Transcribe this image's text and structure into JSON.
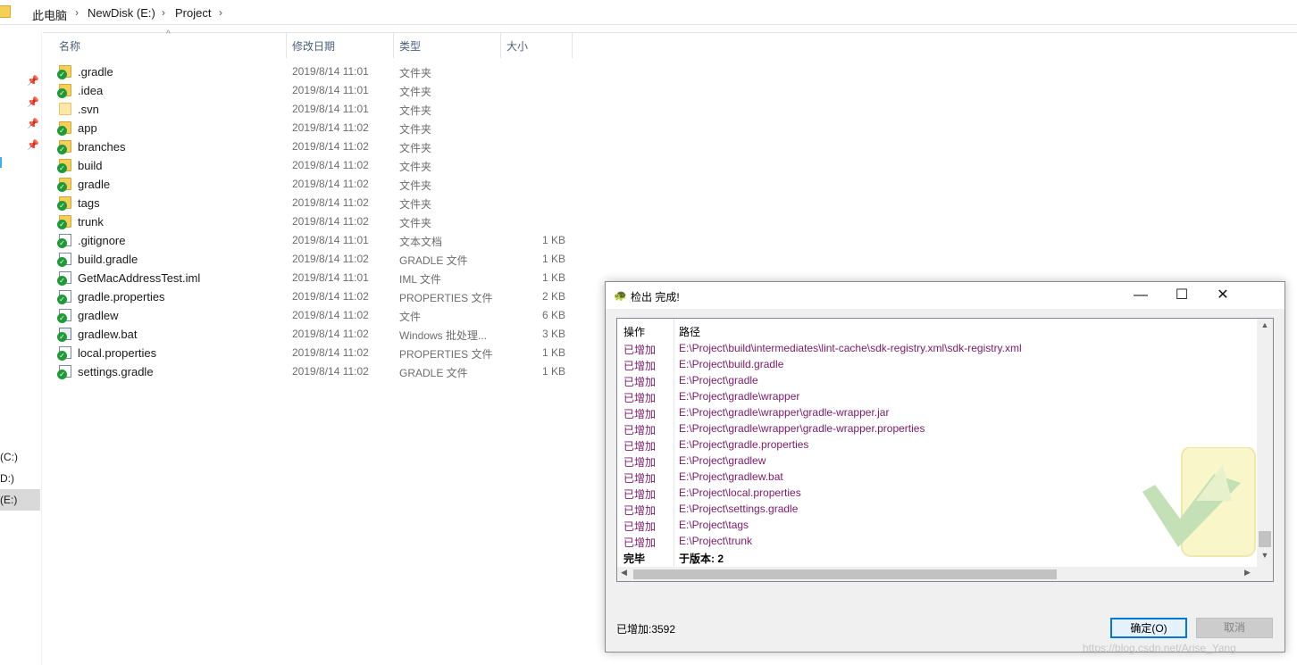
{
  "address_bar": {
    "crumbs": [
      "此电脑",
      "NewDisk (E:)",
      "Project"
    ],
    "separator": "›"
  },
  "columns": {
    "name": "名称",
    "date": "修改日期",
    "type": "类型",
    "size": "大小"
  },
  "nav": {
    "drives": [
      "(C:)",
      "D:)",
      "(E:)"
    ],
    "selected_drive": "(E:)"
  },
  "files": [
    {
      "name": ".gradle",
      "date": "2019/8/14 11:01",
      "type": "文件夹",
      "size": "",
      "icon": "folder-svn-ok-icon"
    },
    {
      "name": ".idea",
      "date": "2019/8/14 11:01",
      "type": "文件夹",
      "size": "",
      "icon": "folder-svn-ok-icon"
    },
    {
      "name": ".svn",
      "date": "2019/8/14 11:01",
      "type": "文件夹",
      "size": "",
      "icon": "folder-icon"
    },
    {
      "name": "app",
      "date": "2019/8/14 11:02",
      "type": "文件夹",
      "size": "",
      "icon": "folder-svn-ok-icon"
    },
    {
      "name": "branches",
      "date": "2019/8/14 11:02",
      "type": "文件夹",
      "size": "",
      "icon": "folder-svn-ok-icon"
    },
    {
      "name": "build",
      "date": "2019/8/14 11:02",
      "type": "文件夹",
      "size": "",
      "icon": "folder-svn-ok-icon"
    },
    {
      "name": "gradle",
      "date": "2019/8/14 11:02",
      "type": "文件夹",
      "size": "",
      "icon": "folder-svn-ok-icon"
    },
    {
      "name": "tags",
      "date": "2019/8/14 11:02",
      "type": "文件夹",
      "size": "",
      "icon": "folder-svn-ok-icon"
    },
    {
      "name": "trunk",
      "date": "2019/8/14 11:02",
      "type": "文件夹",
      "size": "",
      "icon": "folder-svn-ok-icon"
    },
    {
      "name": ".gitignore",
      "date": "2019/8/14 11:01",
      "type": "文本文档",
      "size": "1 KB",
      "icon": "file-svn-ok-icon"
    },
    {
      "name": "build.gradle",
      "date": "2019/8/14 11:02",
      "type": "GRADLE 文件",
      "size": "1 KB",
      "icon": "file-svn-ok-icon"
    },
    {
      "name": "GetMacAddressTest.iml",
      "date": "2019/8/14 11:01",
      "type": "IML 文件",
      "size": "1 KB",
      "icon": "file-svn-ok-icon"
    },
    {
      "name": "gradle.properties",
      "date": "2019/8/14 11:02",
      "type": "PROPERTIES 文件",
      "size": "2 KB",
      "icon": "file-svn-ok-icon"
    },
    {
      "name": "gradlew",
      "date": "2019/8/14 11:02",
      "type": "文件",
      "size": "6 KB",
      "icon": "file-svn-ok-icon"
    },
    {
      "name": "gradlew.bat",
      "date": "2019/8/14 11:02",
      "type": "Windows 批处理...",
      "size": "3 KB",
      "icon": "bat-svn-ok-icon"
    },
    {
      "name": "local.properties",
      "date": "2019/8/14 11:02",
      "type": "PROPERTIES 文件",
      "size": "1 KB",
      "icon": "file-svn-ok-icon"
    },
    {
      "name": "settings.gradle",
      "date": "2019/8/14 11:02",
      "type": "GRADLE 文件",
      "size": "1 KB",
      "icon": "file-svn-ok-icon"
    }
  ],
  "dialog": {
    "title": "检出 完成!",
    "minimize": "—",
    "maximize": "☐",
    "close": "✕",
    "col_action": "操作",
    "col_path": "路径",
    "rows": [
      {
        "action": "已增加",
        "path": "E:\\Project\\build\\intermediates\\lint-cache\\sdk-registry.xml\\sdk-registry.xml"
      },
      {
        "action": "已增加",
        "path": "E:\\Project\\build.gradle"
      },
      {
        "action": "已增加",
        "path": "E:\\Project\\gradle"
      },
      {
        "action": "已增加",
        "path": "E:\\Project\\gradle\\wrapper"
      },
      {
        "action": "已增加",
        "path": "E:\\Project\\gradle\\wrapper\\gradle-wrapper.jar"
      },
      {
        "action": "已增加",
        "path": "E:\\Project\\gradle\\wrapper\\gradle-wrapper.properties"
      },
      {
        "action": "已增加",
        "path": "E:\\Project\\gradle.properties"
      },
      {
        "action": "已增加",
        "path": "E:\\Project\\gradlew"
      },
      {
        "action": "已增加",
        "path": "E:\\Project\\gradlew.bat"
      },
      {
        "action": "已增加",
        "path": "E:\\Project\\local.properties"
      },
      {
        "action": "已增加",
        "path": "E:\\Project\\settings.gradle"
      },
      {
        "action": "已增加",
        "path": "E:\\Project\\tags"
      },
      {
        "action": "已增加",
        "path": "E:\\Project\\trunk"
      },
      {
        "action": "完毕",
        "path": "于版本: 2",
        "bold": true
      }
    ],
    "status": "已增加:3592",
    "ok_label": "确定(O)",
    "cancel_label": "取消"
  },
  "watermark": "https://blog.csdn.net/Arise_Yang",
  "colors": {
    "added_text": "#7a1a68",
    "svn_ok_green": "#1e9a37",
    "folder_yellow": "#f6cf57",
    "header_blue": "#4c607a",
    "ok_border": "#0078d7"
  }
}
